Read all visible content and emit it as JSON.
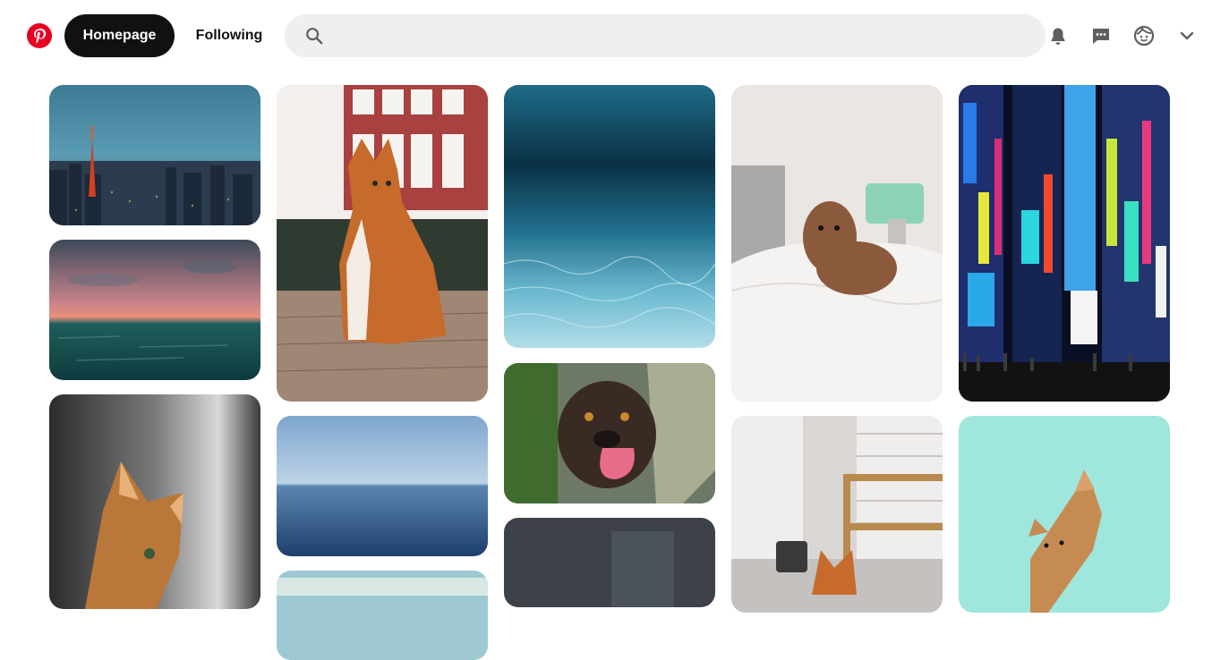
{
  "header": {
    "logo_icon": "pinterest-logo-icon",
    "nav": {
      "home_label": "Homepage",
      "following_label": "Following"
    },
    "search": {
      "value": "",
      "placeholder": ""
    },
    "icons": [
      "search-icon",
      "bell-icon",
      "chat-icon",
      "avatar-icon",
      "chevron-down-icon"
    ]
  },
  "colors": {
    "brand": "#e60023",
    "active_nav": "#111111",
    "search_bg": "#efefef",
    "icon": "#5f5f5f"
  },
  "pins": [
    {
      "name": "tokyo-tower-skyline"
    },
    {
      "name": "sunset-ocean"
    },
    {
      "name": "orange-cat-portrait"
    },
    {
      "name": "orange-cat-sitting-street"
    },
    {
      "name": "calm-blue-sea"
    },
    {
      "name": "beach-shore"
    },
    {
      "name": "underwater-ocean"
    },
    {
      "name": "dog-licking"
    },
    {
      "name": "dark-photo"
    },
    {
      "name": "puppy-on-bed"
    },
    {
      "name": "cat-by-window"
    },
    {
      "name": "neon-city-street"
    },
    {
      "name": "kitten-teal-background"
    }
  ]
}
